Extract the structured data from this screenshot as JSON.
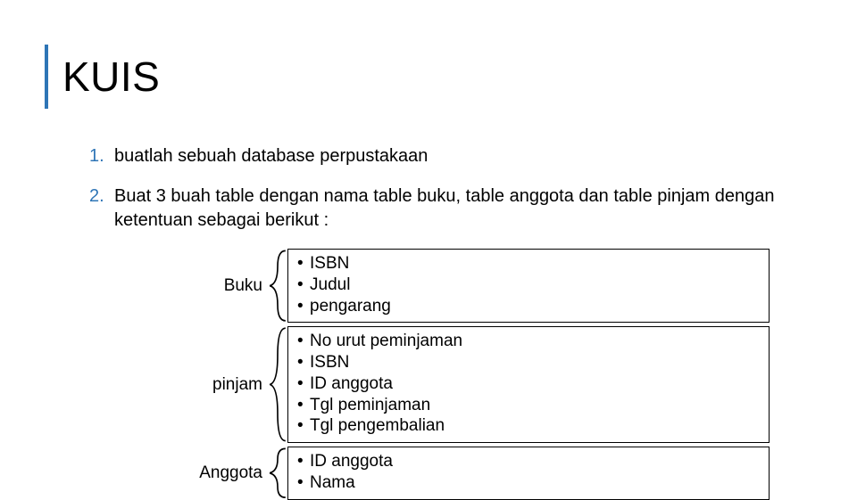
{
  "title": "KUIS",
  "items": [
    {
      "num": "1.",
      "text": "buatlah sebuah database perpustakaan"
    },
    {
      "num": "2.",
      "text": "Buat 3 buah table dengan nama table buku, table anggota dan table pinjam dengan ketentuan sebagai berikut :"
    }
  ],
  "tables": [
    {
      "label": "Buku",
      "fields": [
        "ISBN",
        "Judul",
        "pengarang"
      ]
    },
    {
      "label": "pinjam",
      "fields": [
        "No urut peminjaman",
        "ISBN",
        "ID anggota",
        "Tgl peminjaman",
        "Tgl pengembalian"
      ]
    },
    {
      "label": "Anggota",
      "fields": [
        "ID anggota",
        "Nama"
      ]
    }
  ]
}
